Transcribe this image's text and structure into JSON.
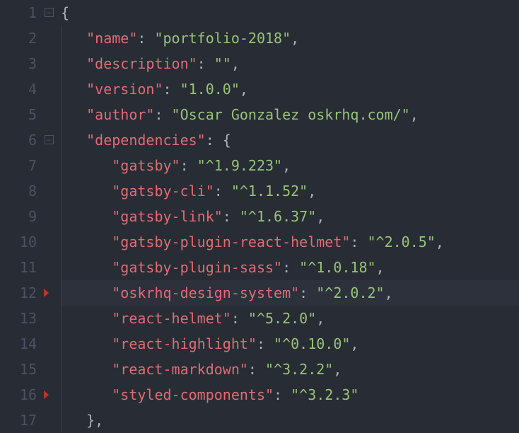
{
  "gutter": {
    "start": 1,
    "end": 17,
    "foldLines": [
      1,
      6
    ],
    "markerLines": [
      12,
      16
    ]
  },
  "lines": {
    "1": {
      "indent": 0,
      "tokens": [
        [
          "brace",
          "{"
        ]
      ]
    },
    "2": {
      "indent": 1,
      "tokens": [
        [
          "key",
          "\"name\""
        ],
        [
          "colon",
          ": "
        ],
        [
          "str",
          "\"portfolio-2018\""
        ],
        [
          "comma",
          ","
        ]
      ]
    },
    "3": {
      "indent": 1,
      "tokens": [
        [
          "key",
          "\"description\""
        ],
        [
          "colon",
          ": "
        ],
        [
          "str",
          "\"\""
        ],
        [
          "comma",
          ","
        ]
      ]
    },
    "4": {
      "indent": 1,
      "tokens": [
        [
          "key",
          "\"version\""
        ],
        [
          "colon",
          ": "
        ],
        [
          "str",
          "\"1.0.0\""
        ],
        [
          "comma",
          ","
        ]
      ]
    },
    "5": {
      "indent": 1,
      "tokens": [
        [
          "key",
          "\"author\""
        ],
        [
          "colon",
          ": "
        ],
        [
          "str",
          "\"Oscar Gonzalez oskrhq.com/\""
        ],
        [
          "comma",
          ","
        ]
      ]
    },
    "6": {
      "indent": 1,
      "tokens": [
        [
          "key",
          "\"dependencies\""
        ],
        [
          "colon",
          ": "
        ],
        [
          "brace",
          "{"
        ]
      ]
    },
    "7": {
      "indent": 2,
      "tokens": [
        [
          "key",
          "\"gatsby\""
        ],
        [
          "colon",
          ": "
        ],
        [
          "str",
          "\"^1.9.223\""
        ],
        [
          "comma",
          ","
        ]
      ]
    },
    "8": {
      "indent": 2,
      "tokens": [
        [
          "key",
          "\"gatsby-cli\""
        ],
        [
          "colon",
          ": "
        ],
        [
          "str",
          "\"^1.1.52\""
        ],
        [
          "comma",
          ","
        ]
      ]
    },
    "9": {
      "indent": 2,
      "tokens": [
        [
          "key",
          "\"gatsby-link\""
        ],
        [
          "colon",
          ": "
        ],
        [
          "str",
          "\"^1.6.37\""
        ],
        [
          "comma",
          ","
        ]
      ]
    },
    "10": {
      "indent": 2,
      "tokens": [
        [
          "key",
          "\"gatsby-plugin-react-helmet\""
        ],
        [
          "colon",
          ": "
        ],
        [
          "str",
          "\"^2.0.5\""
        ],
        [
          "comma",
          ","
        ]
      ]
    },
    "11": {
      "indent": 2,
      "tokens": [
        [
          "key",
          "\"gatsby-plugin-sass\""
        ],
        [
          "colon",
          ": "
        ],
        [
          "str",
          "\"^1.0.18\""
        ],
        [
          "comma",
          ","
        ]
      ]
    },
    "12": {
      "indent": 2,
      "highlight": true,
      "tokens": [
        [
          "key",
          "\"oskrhq-design-system\""
        ],
        [
          "colon",
          ": "
        ],
        [
          "str",
          "\"^2.0.2\""
        ],
        [
          "comma",
          ","
        ]
      ]
    },
    "13": {
      "indent": 2,
      "tokens": [
        [
          "key",
          "\"react-helmet\""
        ],
        [
          "colon",
          ": "
        ],
        [
          "str",
          "\"^5.2.0\""
        ],
        [
          "comma",
          ","
        ]
      ]
    },
    "14": {
      "indent": 2,
      "tokens": [
        [
          "key",
          "\"react-highlight\""
        ],
        [
          "colon",
          ": "
        ],
        [
          "str",
          "\"^0.10.0\""
        ],
        [
          "comma",
          ","
        ]
      ]
    },
    "15": {
      "indent": 2,
      "tokens": [
        [
          "key",
          "\"react-markdown\""
        ],
        [
          "colon",
          ": "
        ],
        [
          "str",
          "\"^3.2.2\""
        ],
        [
          "comma",
          ","
        ]
      ]
    },
    "16": {
      "indent": 2,
      "tokens": [
        [
          "key",
          "\"styled-components\""
        ],
        [
          "colon",
          ": "
        ],
        [
          "str",
          "\"^3.2.3\""
        ]
      ]
    },
    "17": {
      "indent": 1,
      "tokens": [
        [
          "brace",
          "}"
        ],
        [
          "comma",
          ","
        ]
      ]
    }
  }
}
